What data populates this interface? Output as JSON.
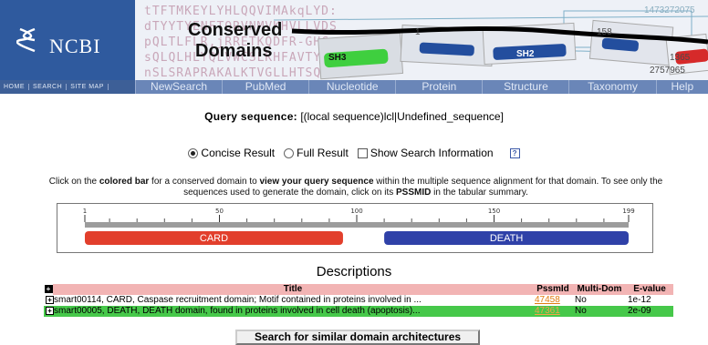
{
  "header": {
    "logo_text": "NCBI",
    "title_line1": "Conserved",
    "title_line2": "Domains",
    "bg_sequence": [
      "tTFTMKEYLYHLQQVIMAkqLYD:",
      "dTYYTYENFTQRVNMVKHVLLVDS",
      "pQLTLFLR,jRRETKQDFR-GHC",
      "sQLQLHLYQLVWCSLKHFAVTYLK",
      "nSLSRAPRAKALKTVGLLHTSQR"
    ],
    "art_labels": {
      "sh3": "SH3",
      "sh2": "SH2",
      "n1": "1",
      "n2": "158",
      "n3": "1473272075",
      "n4": "1365",
      "n5": "2757965"
    }
  },
  "nav": {
    "small": [
      "HOME",
      "SEARCH",
      "SITE MAP"
    ],
    "items": [
      "NewSearch",
      "PubMed",
      "Nucleotide",
      "Protein",
      "Structure",
      "Taxonomy",
      "Help"
    ]
  },
  "query": {
    "label": "Query sequence:",
    "value": "[(local sequence)lcl|Undefined_sequence]"
  },
  "options": {
    "concise": "Concise Result",
    "full": "Full Result",
    "show_info": "Show Search Information",
    "help": "?"
  },
  "instructions": {
    "p1": "Click on the ",
    "b1": "colored bar",
    "p2": " for a conserved domain to ",
    "b2": "view your query sequence",
    "p3": " within the multiple sequence alignment for that domain. To see only the sequences used to generate the domain, click on its ",
    "b3": "PSSMID",
    "p4": " in the tabular summary."
  },
  "ruler": {
    "ticks": [
      "1",
      "50",
      "100",
      "150",
      "199"
    ],
    "max": 199,
    "domains": [
      {
        "name": "CARD",
        "start": 1,
        "end": 95,
        "color": "#e23f2c"
      },
      {
        "name": "DEATH",
        "start": 110,
        "end": 199,
        "color": "#2f41a8"
      }
    ]
  },
  "descriptions": {
    "heading": "Descriptions",
    "col_title": "Title",
    "col_pssmid": "PssmId",
    "col_multidom": "Multi-Dom",
    "col_evalue": "E-value",
    "rows": [
      {
        "title": "smart00114, CARD, Caspase recruitment domain; Motif contained in proteins involved in ...",
        "pssmid": "47458",
        "multidom": "No",
        "evalue": "1e-12"
      },
      {
        "title": "smart00005, DEATH, DEATH domain, found in proteins involved in cell death (apoptosis)...",
        "pssmid": "47361",
        "multidom": "No",
        "evalue": "2e-09"
      }
    ]
  },
  "search_button": "Search for similar domain architectures"
}
